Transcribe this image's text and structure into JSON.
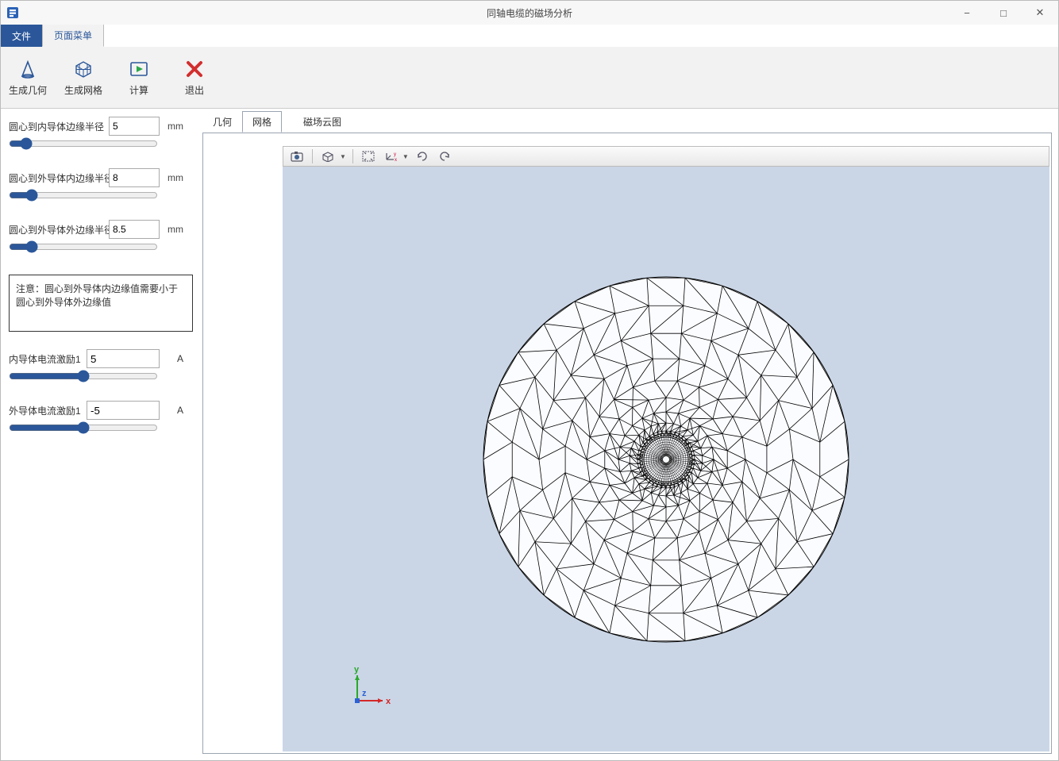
{
  "window": {
    "title": "同轴电缆的磁场分析",
    "minimize": "−",
    "maximize": "□",
    "close": "✕"
  },
  "menubar": {
    "file": "文件",
    "page": "页面菜单"
  },
  "ribbon": {
    "build_geometry": "生成几何",
    "build_mesh": "生成网格",
    "compute": "计算",
    "exit": "退出"
  },
  "params": {
    "r1_label": "圆心到内导体边缘半径",
    "r1_value": "5",
    "r1_unit": "mm",
    "r2_label": "圆心到外导体内边缘半径",
    "r2_value": "8",
    "r2_unit": "mm",
    "r3_label": "圆心到外导体外边缘半径",
    "r3_value": "8.5",
    "r3_unit": "mm",
    "note": "注意：圆心到外导体内边缘值需要小于圆心到外导体外边缘值",
    "i1_label": "内导体电流激励1",
    "i1_value": "5",
    "i1_unit": "A",
    "i2_label": "外导体电流激励1",
    "i2_value": "-5",
    "i2_unit": "A"
  },
  "viewer_tabs": {
    "geometry": "几何",
    "mesh": "网格",
    "field_plot": "磁场云图"
  },
  "axes": {
    "x": "x",
    "y": "y",
    "z": "z"
  }
}
